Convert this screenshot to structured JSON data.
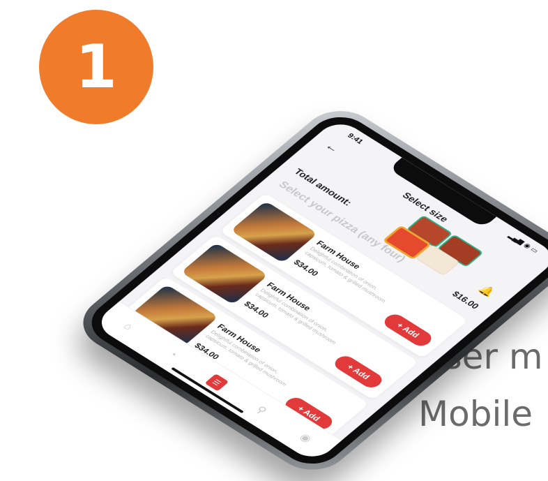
{
  "step": {
    "number": "1"
  },
  "caption": {
    "line1": "User m",
    "line2": "Mobile"
  },
  "screen": {
    "status_time": "9:41",
    "status_icons": "▂▄▆ ◉ ▭",
    "title": "Select size",
    "total_label": "Total amount:",
    "select_prompt": "Select your pizza (any four)",
    "total_amount": "$16.00"
  },
  "items": [
    {
      "name": "Farm House",
      "desc": "Delightful combination of onion, capsicum, tomato & grilled mushroom",
      "price": "$34.00",
      "add_label": "+ Add"
    },
    {
      "name": "Farm House",
      "desc": "Delightful combination of onion, capsicum, tomato & grilled mushroom",
      "price": "$34.00",
      "add_label": "+ Add"
    },
    {
      "name": "Farm House",
      "desc": "Delightful combination of onion, capsicum, tomato & grilled mushroom",
      "price": "$34.00",
      "add_label": "+ Add"
    }
  ],
  "nav": [
    {
      "icon": "home-icon",
      "glyph": "⌂"
    },
    {
      "icon": "bell-icon",
      "glyph": "◔"
    },
    {
      "icon": "menu-icon",
      "glyph": "☰"
    },
    {
      "icon": "cart-icon",
      "glyph": "⚲"
    },
    {
      "icon": "profile-icon",
      "glyph": "◉"
    }
  ],
  "colors": {
    "accent": "#e23a3a",
    "badge": "#ef7b2b",
    "caption": "#6b6b6b"
  }
}
